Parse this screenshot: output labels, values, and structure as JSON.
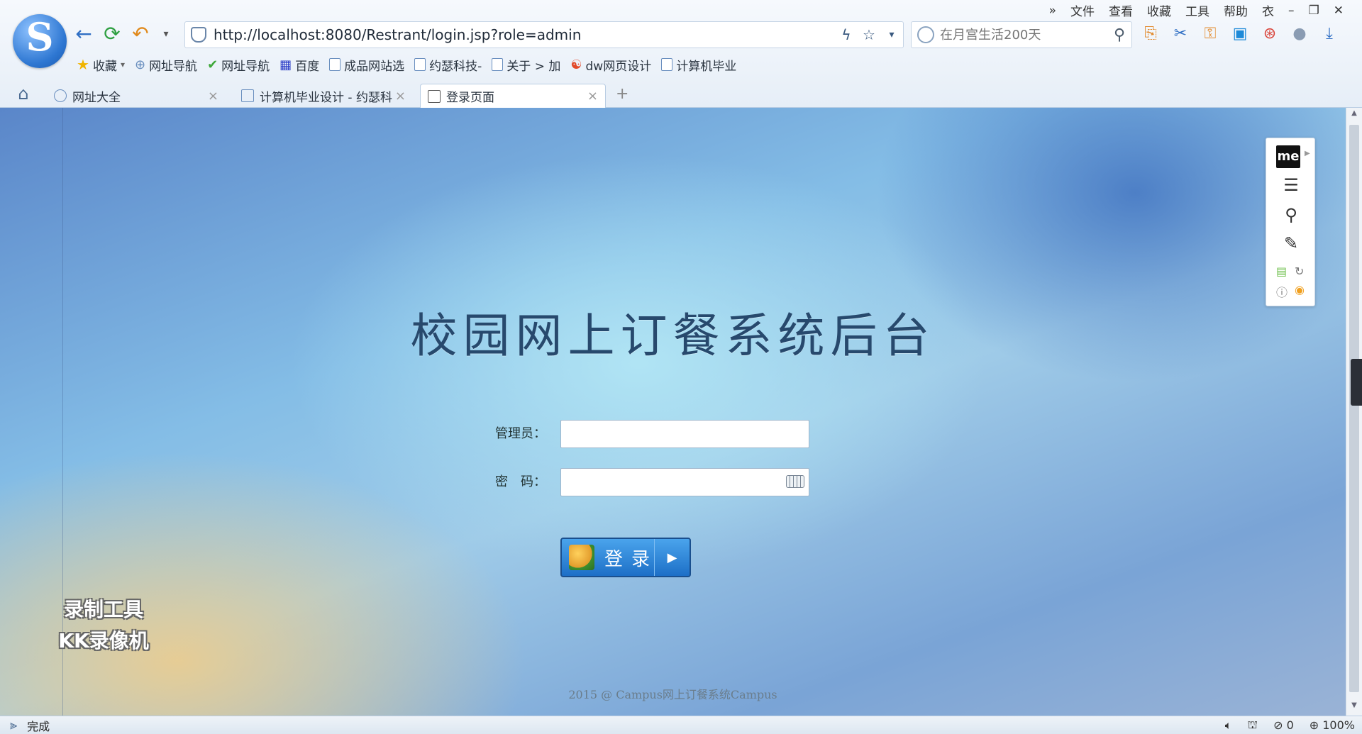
{
  "browser": {
    "menu": [
      "文件",
      "查看",
      "收藏",
      "工具",
      "帮助"
    ],
    "window_controls": {
      "more": "»",
      "skin": "衣",
      "minimize": "–",
      "restore": "❐",
      "close": "✕"
    },
    "url": "http://localhost:8080/Restrant/login.jsp?role=admin",
    "search_placeholder": "在月宫生活200天",
    "bookmarks": [
      {
        "label": "收藏",
        "icon": "star-icon"
      },
      {
        "label": "网址导航",
        "icon": "globe-icon"
      },
      {
        "label": "网址导航",
        "icon": "hao123-icon"
      },
      {
        "label": "百度",
        "icon": "baidu-icon"
      },
      {
        "label": "成品网站选",
        "icon": "page-icon"
      },
      {
        "label": "约瑟科技-",
        "icon": "page-icon"
      },
      {
        "label": "关于 > 加",
        "icon": "page-icon"
      },
      {
        "label": "dw网页设计",
        "icon": "dw-icon"
      },
      {
        "label": "计算机毕业",
        "icon": "page-icon"
      }
    ],
    "tabs": [
      {
        "label": "网址大全",
        "active": false
      },
      {
        "label": "计算机毕业设计 - 约瑟科",
        "active": false
      },
      {
        "label": "登录页面",
        "active": true
      }
    ],
    "status": {
      "text": "完成",
      "zoom": "100%",
      "block_count": "0"
    }
  },
  "page": {
    "title": "校园网上订餐系统后台",
    "admin_label": "管理员：",
    "admin_value": "",
    "password_label": "密　码：",
    "password_value": "",
    "login_button": "登录",
    "footer": "2015 @ Campus网上订餐系统Campus",
    "watermark": [
      "录制工具",
      "KK录像机"
    ]
  },
  "side_panel": {
    "brand": "me"
  }
}
